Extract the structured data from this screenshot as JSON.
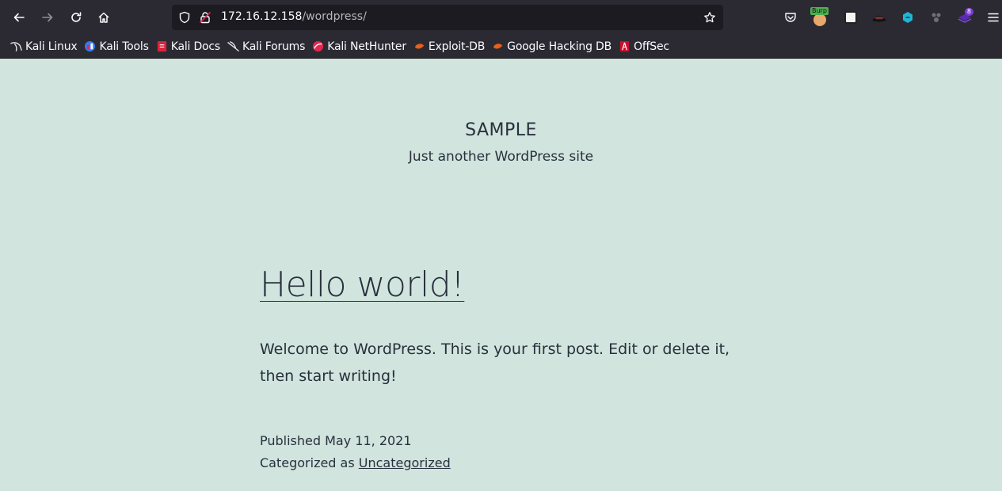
{
  "browser": {
    "url_host": "172.16.12.158",
    "url_path": "/wordpress/",
    "extensions": [
      {
        "name": "pocket-icon"
      },
      {
        "name": "burp-icon",
        "badge": "Burp"
      },
      {
        "name": "extension-panda-icon"
      },
      {
        "name": "hat-icon"
      },
      {
        "name": "wappalyzer-icon"
      },
      {
        "name": "puzzle-icon"
      },
      {
        "name": "stack-icon",
        "badge": "8"
      }
    ],
    "bookmarks": [
      {
        "label": "Kali Linux",
        "icon": "kali-dragon-icon"
      },
      {
        "label": "Kali Tools",
        "icon": "kali-tools-icon"
      },
      {
        "label": "Kali Docs",
        "icon": "kali-docs-icon"
      },
      {
        "label": "Kali Forums",
        "icon": "kali-forums-icon"
      },
      {
        "label": "Kali NetHunter",
        "icon": "nethunter-icon"
      },
      {
        "label": "Exploit-DB",
        "icon": "exploitdb-icon"
      },
      {
        "label": "Google Hacking DB",
        "icon": "ghdb-icon"
      },
      {
        "label": "OffSec",
        "icon": "offsec-icon"
      }
    ]
  },
  "site": {
    "title": "SAMPLE",
    "description": "Just another WordPress site"
  },
  "post": {
    "title": "Hello world!",
    "content": "Welcome to WordPress. This is your first post. Edit or delete it, then start writing!",
    "published_prefix": "Published",
    "published_date": "May 11, 2021",
    "category_prefix": "Categorized as",
    "category": "Uncategorized"
  },
  "colors": {
    "page_bg": "#d1e4dd",
    "text": "#28303d",
    "chrome_bg": "#2b2a33",
    "urlbar_bg": "#1c1b22"
  }
}
